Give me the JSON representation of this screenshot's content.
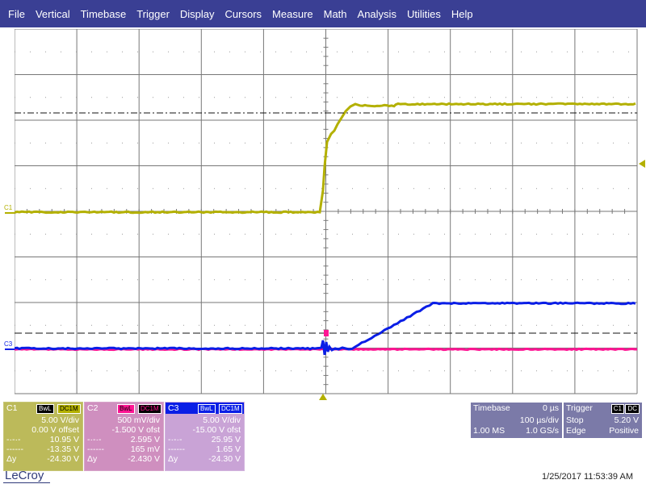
{
  "menu": [
    "File",
    "Vertical",
    "Timebase",
    "Trigger",
    "Display",
    "Cursors",
    "Measure",
    "Math",
    "Analysis",
    "Utilities",
    "Help"
  ],
  "colors": {
    "c1": "#b3b000",
    "c2": "#ff1493",
    "c3": "#0a1ee6",
    "grid": "#6b6b6b",
    "menubar": "#3a3f94",
    "c1_panel": "#bcba5a",
    "c2_panel": "#cf8fbf",
    "c3_panel": "#c9a3d6",
    "right_panel": "#7b7aa8"
  },
  "markers": {
    "c1": "C1",
    "c3": "C3"
  },
  "channels": [
    {
      "id": "C1",
      "tags": [
        "BwL",
        "DC1M"
      ],
      "scale": "5.00 V/div",
      "offset": "0.00 V offset",
      "cursor1": "10.95 V",
      "cursor2": "-13.35 V",
      "delta_label": "Δy",
      "delta": "-24.30 V"
    },
    {
      "id": "C2",
      "tags": [
        "BwL",
        "DC1M"
      ],
      "scale": "500 mV/div",
      "offset": "-1.500 V ofst",
      "cursor1": "2.595 V",
      "cursor2": "165 mV",
      "delta_label": "Δy",
      "delta": "-2.430 V"
    },
    {
      "id": "C3",
      "tags": [
        "BwL",
        "DC1M"
      ],
      "scale": "5.00 V/div",
      "offset": "-15.00 V ofst",
      "cursor1": "25.95 V",
      "cursor2": "1.65 V",
      "delta_label": "Δy",
      "delta": "-24.30 V"
    }
  ],
  "timebase": {
    "label": "Timebase",
    "delay": "0 µs",
    "scale": "100 µs/div",
    "points": "1.00 MS",
    "rate": "1.0 GS/s"
  },
  "trigger": {
    "label": "Trigger",
    "source_tags": [
      "C1",
      "DC"
    ],
    "mode": "Stop",
    "level": "5.20 V",
    "type": "Edge",
    "slope": "Positive"
  },
  "brand": "LeCroy",
  "datetime": "1/25/2017 11:53:39 AM"
}
